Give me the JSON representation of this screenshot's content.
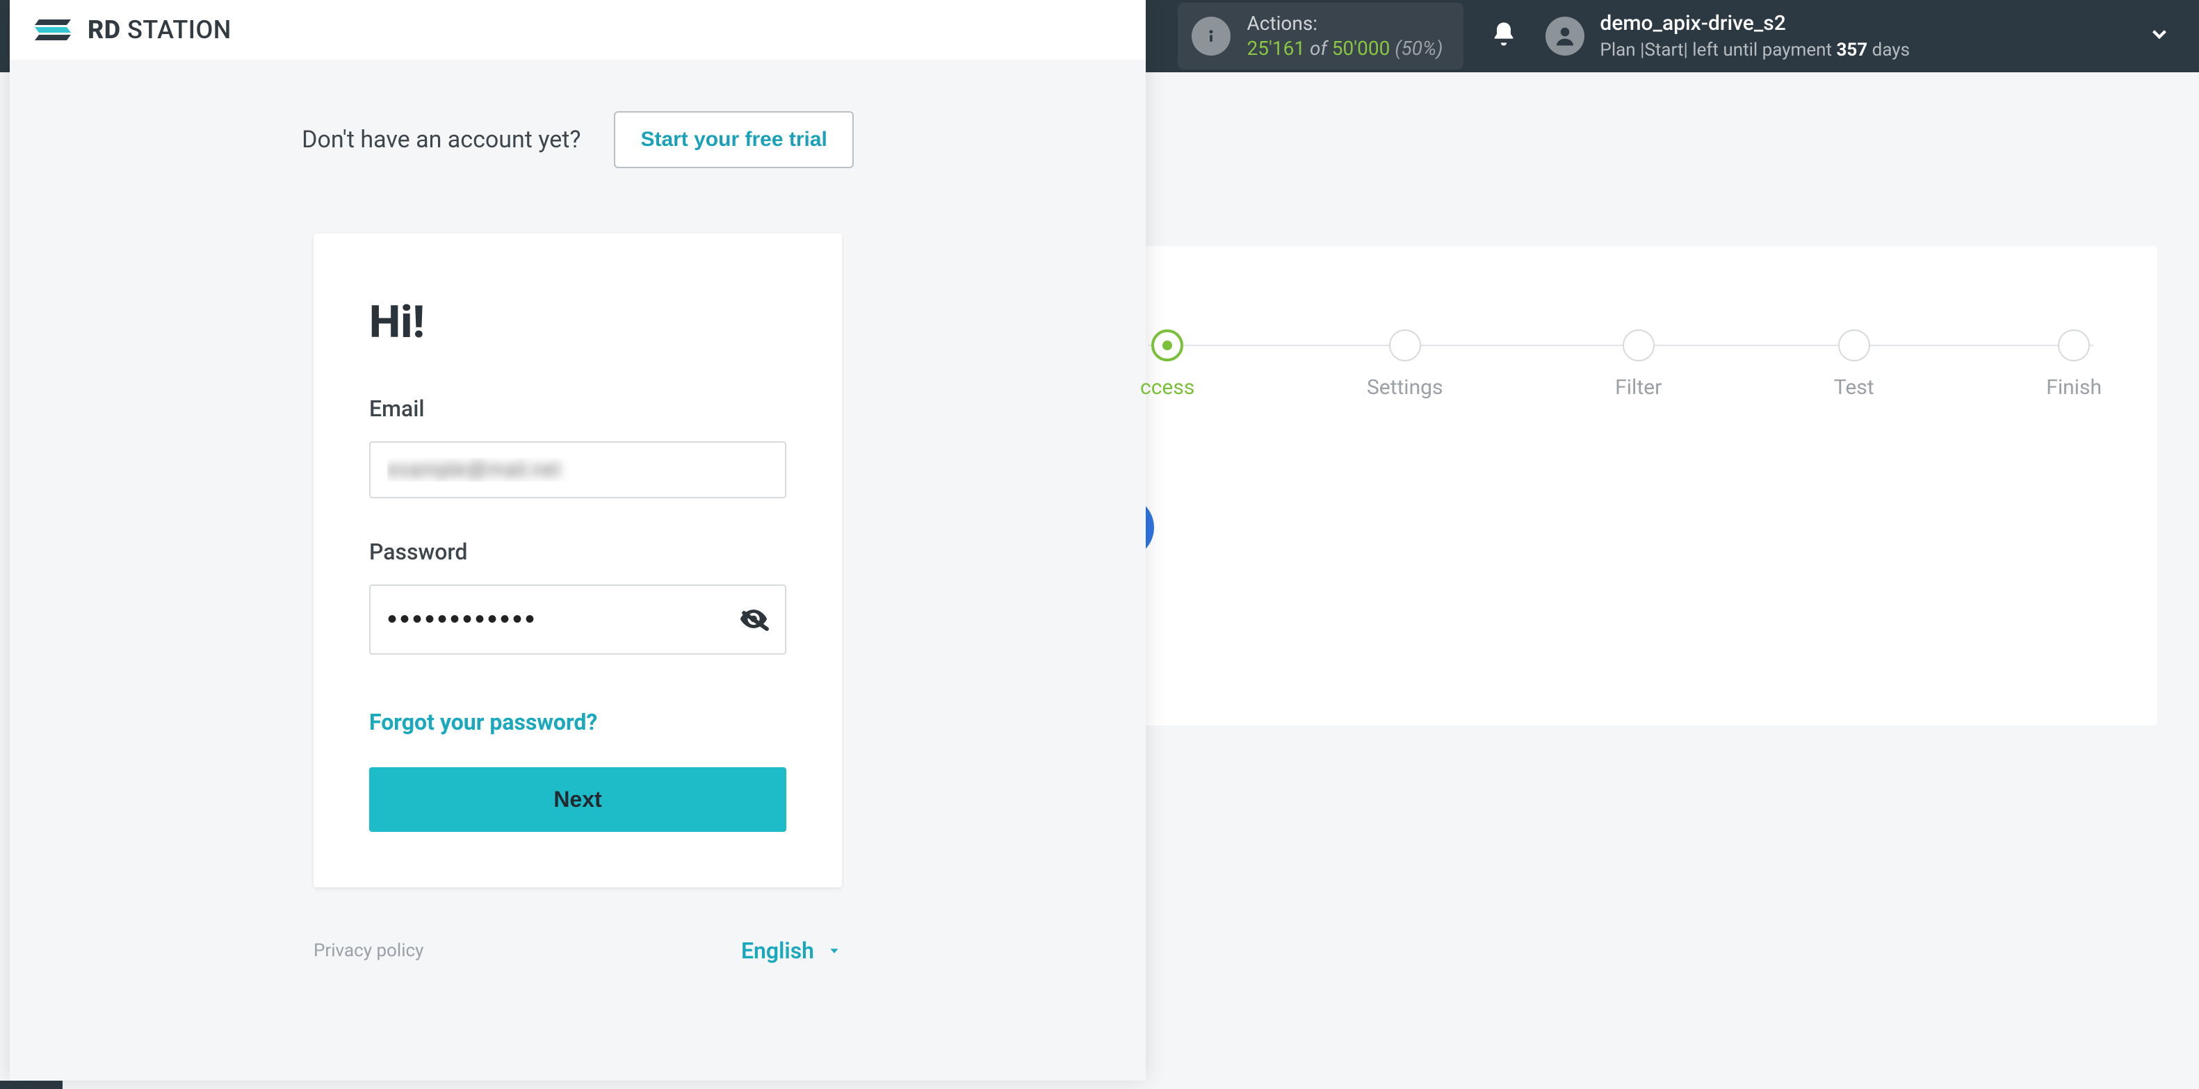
{
  "header": {
    "actions_label": "Actions:",
    "actions_used": "25'161",
    "actions_of": " of ",
    "actions_total": "50'000",
    "actions_pct": " (50%)",
    "user_name": "demo_apix-drive_s2",
    "plan_prefix": "Plan |Start|  left until payment ",
    "plan_days": "357",
    "plan_suffix": " days"
  },
  "workflow": {
    "steps": [
      {
        "label": "ccess",
        "active": true
      },
      {
        "label": "Settings",
        "active": false
      },
      {
        "label": "Filter",
        "active": false
      },
      {
        "label": "Test",
        "active": false
      },
      {
        "label": "Finish",
        "active": false
      }
    ]
  },
  "rd": {
    "logo_bold": "RD",
    "logo_rest": " STATION",
    "no_account": "Don't have an account yet?",
    "trial_btn": "Start your free trial",
    "hi": "Hi!",
    "email_label": "Email",
    "email_value": "example@mail.net",
    "password_label": "Password",
    "password_value": "••••••••••••",
    "forgot": "Forgot your password?",
    "next": "Next",
    "privacy": "Privacy policy",
    "language": "English"
  }
}
